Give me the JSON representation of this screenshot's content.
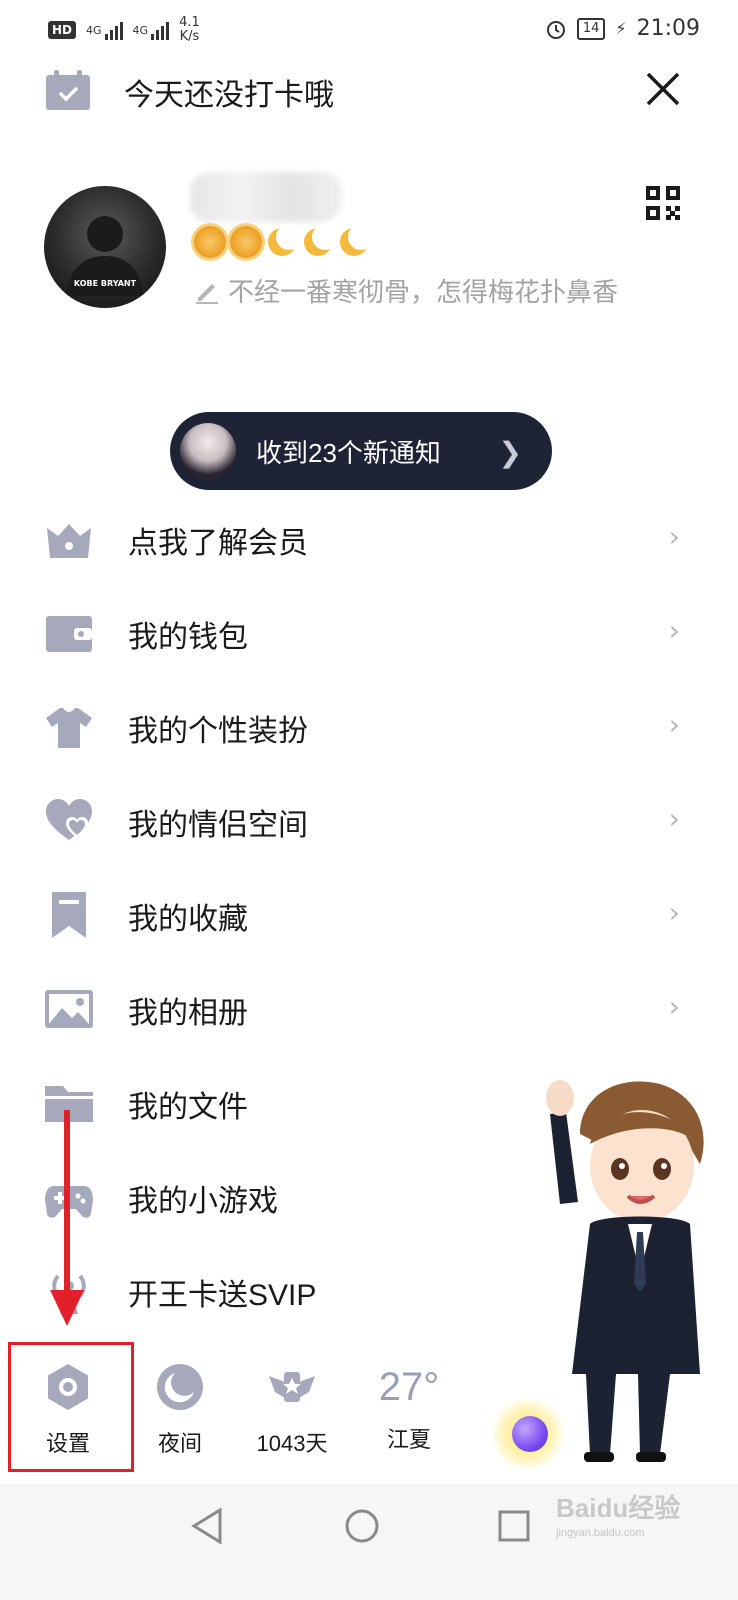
{
  "status_bar": {
    "hd": "HD",
    "sim1": "4G",
    "sim2": "4G",
    "speed_value": "4.1",
    "speed_unit": "K/s",
    "battery": "14",
    "time": "21:09"
  },
  "header": {
    "checkin_text": "今天还没打卡哦"
  },
  "profile": {
    "avatar_caption": "KOBE BRYANT",
    "signature": "不经一番寒彻骨，怎得梅花扑鼻香"
  },
  "notice": {
    "text": "收到23个新通知"
  },
  "menu": [
    {
      "label": "点我了解会员",
      "icon": "crown-icon"
    },
    {
      "label": "我的钱包",
      "icon": "wallet-icon"
    },
    {
      "label": "我的个性装扮",
      "icon": "shirt-icon"
    },
    {
      "label": "我的情侣空间",
      "icon": "hearts-icon"
    },
    {
      "label": "我的收藏",
      "icon": "bookmark-icon"
    },
    {
      "label": "我的相册",
      "icon": "photo-icon"
    },
    {
      "label": "我的文件",
      "icon": "folder-icon"
    },
    {
      "label": "我的小游戏",
      "icon": "gamepad-icon"
    },
    {
      "label": "开王卡送SVIP",
      "icon": "signal-tower-icon"
    }
  ],
  "bottom_bar": {
    "settings": "设置",
    "night": "夜间",
    "days": "1043天",
    "temperature": "27°",
    "city": "江夏"
  },
  "watermark": {
    "brand": "Baidu经验",
    "url": "jingyan.baidu.com"
  },
  "colors": {
    "icon_gray": "#a6a9bc",
    "notice_bg": "#1f2336",
    "annotation_red": "#e2202a"
  }
}
